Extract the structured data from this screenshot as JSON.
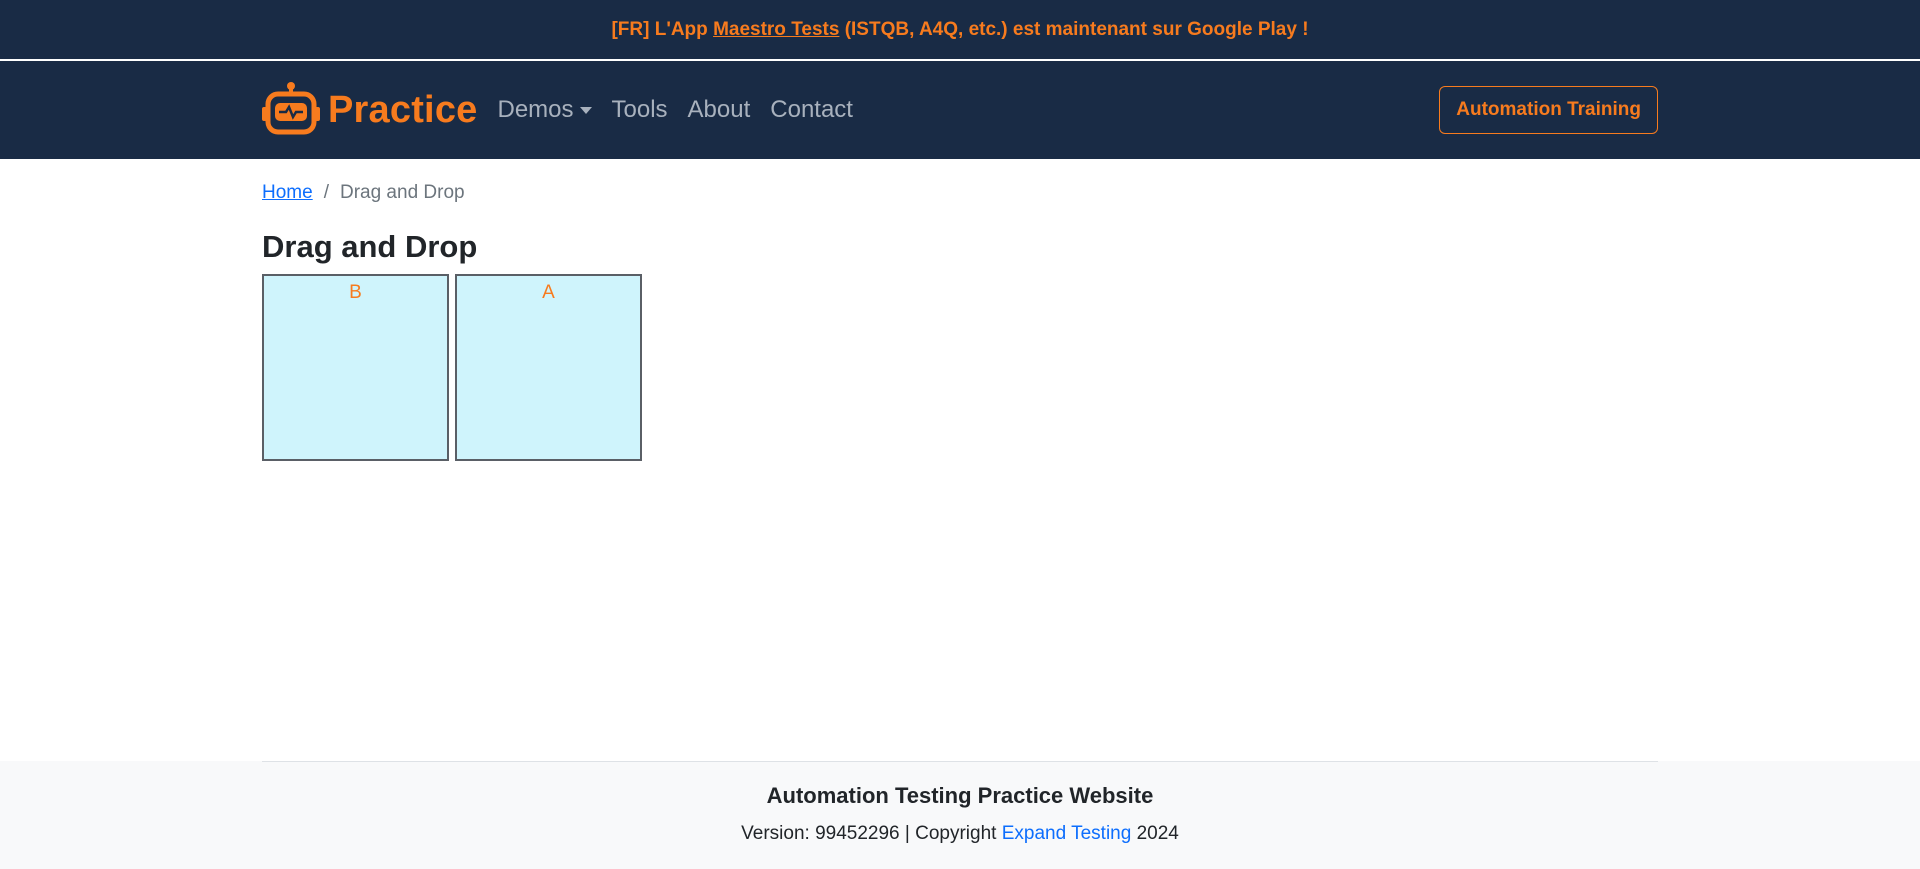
{
  "colors": {
    "navy": "#192b45",
    "accent": "#f77b1e",
    "link": "#0d6efd",
    "box_fill": "#cff4fc"
  },
  "announcement": {
    "prefix": "[FR] L'App ",
    "link_text": "Maestro Tests",
    "suffix": " (ISTQB, A4Q, etc.) est maintenant sur Google Play !"
  },
  "navbar": {
    "logo_icon": "robot-icon",
    "brand": "Practice",
    "items": [
      {
        "label": "Demos",
        "dropdown": true
      },
      {
        "label": "Tools"
      },
      {
        "label": "About"
      },
      {
        "label": "Contact"
      }
    ],
    "cta_label": "Automation Training"
  },
  "breadcrumb": {
    "home": "Home",
    "separator": "/",
    "current": "Drag and Drop"
  },
  "page": {
    "title": "Drag and Drop"
  },
  "columns": [
    {
      "label": "B"
    },
    {
      "label": "A"
    }
  ],
  "footer": {
    "title": "Automation Testing Practice Website",
    "version_prefix": "Version: 99452296 | Copyright ",
    "company": "Expand Testing",
    "year_suffix": " 2024"
  }
}
